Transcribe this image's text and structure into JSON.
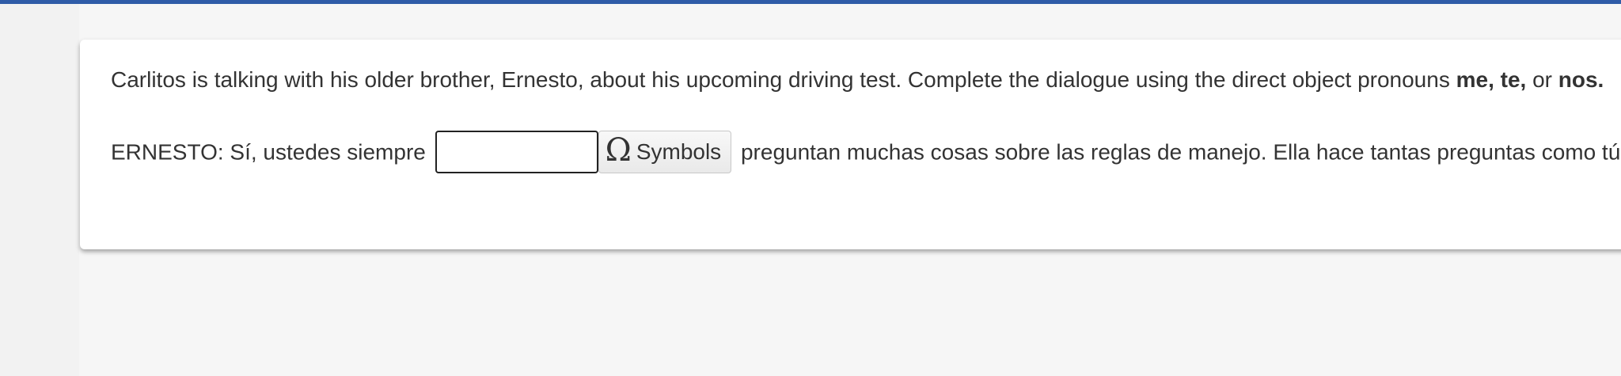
{
  "instructions": {
    "text_before": "Carlitos is talking with his older brother, Ernesto, about his upcoming driving test. Complete the dialogue using the direct object pronouns ",
    "bold_1": "me, te,",
    "text_mid": " or ",
    "bold_2": "nos."
  },
  "dialogue": {
    "before_blank": "ERNESTO: Sí, ustedes siempre",
    "answer_value": "",
    "symbols_label": "Symbols",
    "symbols_icon": "omega-icon",
    "after_blank": "preguntan muchas cosas sobre las reglas de manejo. Ella hace tantas preguntas como tú."
  },
  "colors": {
    "top_bar": "#2f5ca8",
    "text": "#333333",
    "card_bg": "#ffffff",
    "page_bg": "#f6f6f6"
  }
}
